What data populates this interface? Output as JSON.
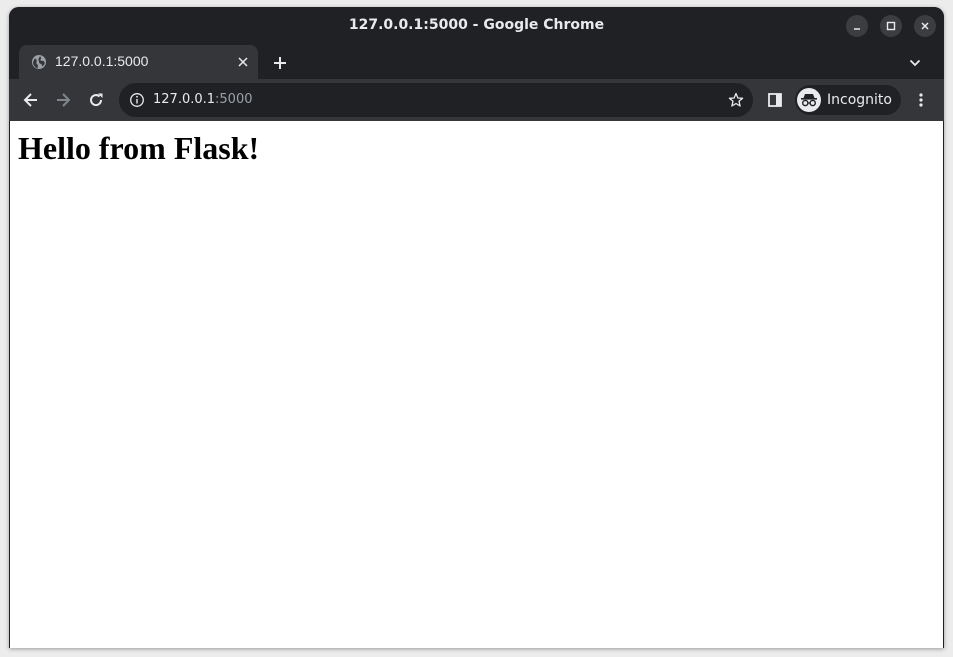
{
  "window": {
    "title": "127.0.0.1:5000 - Google Chrome"
  },
  "tabs": [
    {
      "label": "127.0.0.1:5000",
      "favicon": "globe-icon",
      "active": true
    }
  ],
  "omnibox": {
    "host": "127.0.0.1",
    "port": ":5000",
    "info_icon": "info-icon"
  },
  "profile": {
    "label": "Incognito",
    "icon": "incognito-icon"
  },
  "page": {
    "heading": "Hello from Flask!"
  },
  "colors": {
    "chrome_dark": "#202124",
    "chrome_toolbar": "#35363a",
    "chrome_text": "#e8eaed",
    "chrome_dim_text": "#9aa0a6",
    "page_background": "#ffffff"
  }
}
